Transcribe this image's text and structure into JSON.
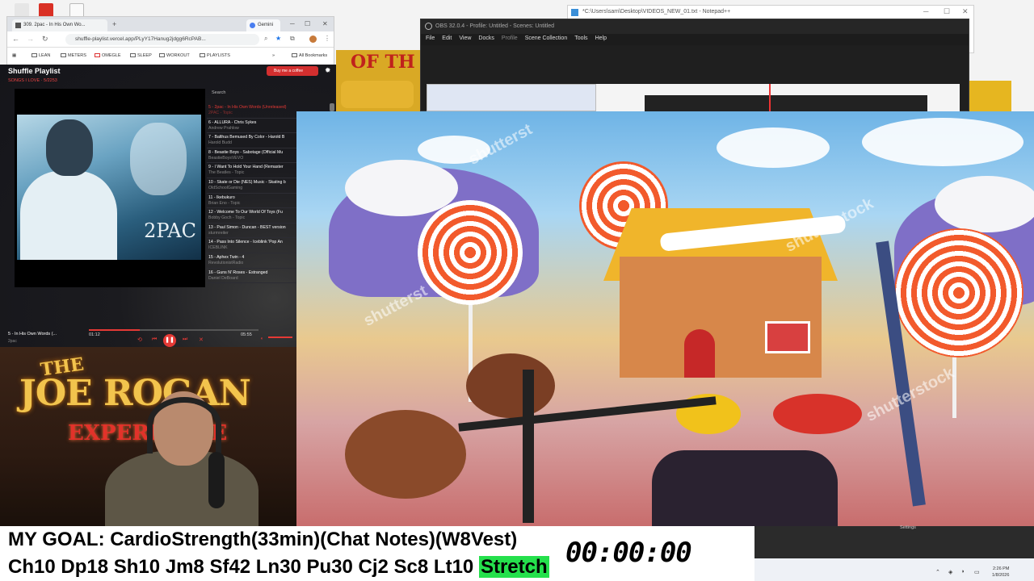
{
  "browser": {
    "tab1_title": "309. 2pac - In His Own Wo...",
    "tab2_title": "Gemini",
    "url": "shuffle-playlist.vercel.app/PLyY17Hanug2jdgg6RcPAB...",
    "bookmarks": [
      "LEAN",
      "METERS",
      "OMEGLE",
      "SLEEP",
      "WORKOUT",
      "PLAYLISTS",
      "All Bookmarks"
    ]
  },
  "notepad": {
    "title": "*C:\\Users\\sam\\Desktop\\VIDEOS_NEW_01.txt - Notepad++"
  },
  "obs": {
    "title": "OBS 32.0.4 - Profile: Untitled - Scenes: Untitled",
    "menu": [
      "File",
      "Edit",
      "View",
      "Docks",
      "Profile",
      "Scene Collection",
      "Tools",
      "Help"
    ]
  },
  "player": {
    "app_title": "Shuffle Playlist",
    "subtitle": "SONGS I LOVE · 5/2253",
    "coffee_label": "Buy me a coffee",
    "album_logo": "2PAC",
    "search_label": "Search",
    "tracks": [
      {
        "title": "5 - 2pac - In His Own Words (Unreleased)",
        "artist": "2PAC - Topic",
        "active": true
      },
      {
        "title": "6 - ALLURA - Chris Sykes",
        "artist": "Andrew Prahlow",
        "active": false
      },
      {
        "title": "7 - Balthus Bemused By Color - Harold B",
        "artist": "Harold Budd",
        "active": false
      },
      {
        "title": "8 - Beastie Boys - Sabotage (Official Mu",
        "artist": "BeastieBoysVEVO",
        "active": false
      },
      {
        "title": "9 - I Want To Hold Your Hand (Remaster",
        "artist": "The Beatles - Topic",
        "active": false
      },
      {
        "title": "10 - Skate or Die (NES) Music - Skating b",
        "artist": "OldSchoolGaming",
        "active": false
      },
      {
        "title": "11 - Ikebukuro",
        "artist": "Brian Eno - Topic",
        "active": false
      },
      {
        "title": "12 - Welcome To Our World Of Toys (Fu",
        "artist": "Bobby Goch - Topic",
        "active": false
      },
      {
        "title": "13 - Paul Simon - Duncan - BEST version",
        "artist": "sturmreiter",
        "active": false
      },
      {
        "title": "14 - Pass Into Silence - Iceblink 'Pop An",
        "artist": "ICEBLINK",
        "active": false
      },
      {
        "title": "15 - Aphex Twin - 4",
        "artist": "RevolutionistRadio",
        "active": false
      },
      {
        "title": "16 - Guns N' Roses - Estranged",
        "artist": "Daniel DeBoard",
        "active": false
      }
    ],
    "now_playing_title": "5 - In His Own Words (...",
    "now_playing_artist": "2pac",
    "time_current": "01:12",
    "time_total": "05:55",
    "progress": 0.3
  },
  "webcam": {
    "sign_the": "THE",
    "sign_name": "JOE ROGAN",
    "sign_exp": "EXPERIENCE"
  },
  "overlay": {
    "goal_line": "MY GOAL: CardioStrength(33min)(Chat Notes)(W8Vest)",
    "stats_line": "Ch10 Dp18 Sh10 Jm8 Sf42 Ln30 Pu30 Cj2 Sc8 Lt10",
    "highlight": "Stretch",
    "timer": "00:00:00"
  },
  "obs_dock": {
    "settings_label": "Settings"
  },
  "taskbar": {
    "time": "2:26 PM",
    "date": "1/8/2026"
  },
  "colors": {
    "accent_red": "#e53935",
    "stretch_green": "#25e04c",
    "obs_dark": "#1f1f1f"
  }
}
